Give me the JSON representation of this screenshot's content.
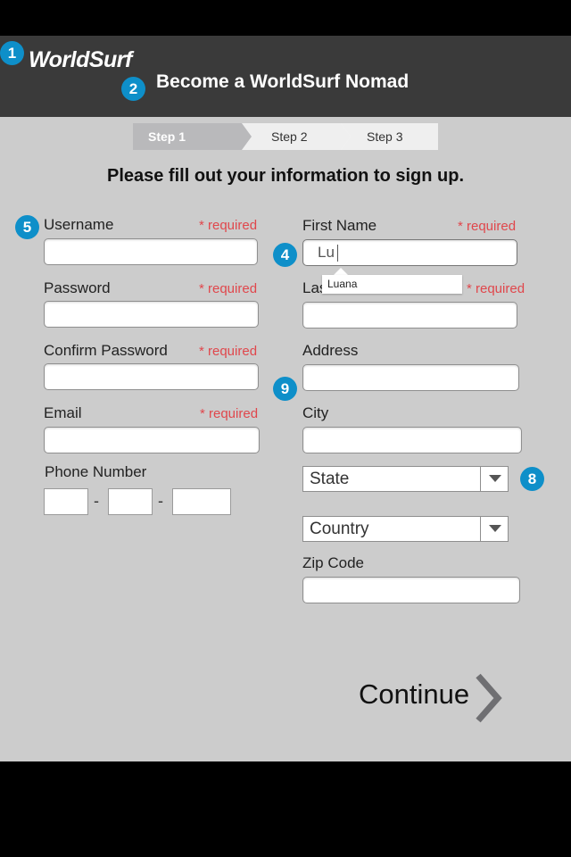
{
  "app": {
    "logo": "WorldSurf",
    "page_title": "Become a WorldSurf Nomad"
  },
  "steps": [
    {
      "label": "Step 1",
      "active": true
    },
    {
      "label": "Step 2",
      "active": false
    },
    {
      "label": "Step 3",
      "active": false
    }
  ],
  "instruction": "Please fill out your information to sign up.",
  "required_text": "* required",
  "left_form": {
    "username": {
      "label": "Username",
      "value": ""
    },
    "password": {
      "label": "Password",
      "value": ""
    },
    "confirm_password": {
      "label": "Confirm Password",
      "value": ""
    },
    "email": {
      "label": "Email",
      "value": ""
    },
    "phone": {
      "label": "Phone Number",
      "separator": "-"
    }
  },
  "right_form": {
    "first_name": {
      "label": "First Name",
      "value": "Lu"
    },
    "last_name": {
      "label": "Last Name",
      "value": ""
    },
    "address": {
      "label": "Address",
      "value": ""
    },
    "city": {
      "label": "City",
      "value": ""
    },
    "state": {
      "selected": "State"
    },
    "country": {
      "selected": "Country"
    },
    "zip": {
      "label": "Zip Code",
      "value": ""
    }
  },
  "autocomplete": {
    "suggestion": "Luana"
  },
  "callouts": [
    "1",
    "2",
    "4",
    "5",
    "8",
    "9"
  ],
  "continue_label": "Continue",
  "colors": {
    "header": "#3a3a3a",
    "content": "#cccccc",
    "required": "#e0474c",
    "callout": "#0e8fc9",
    "active_step": "#b9b9bb"
  }
}
